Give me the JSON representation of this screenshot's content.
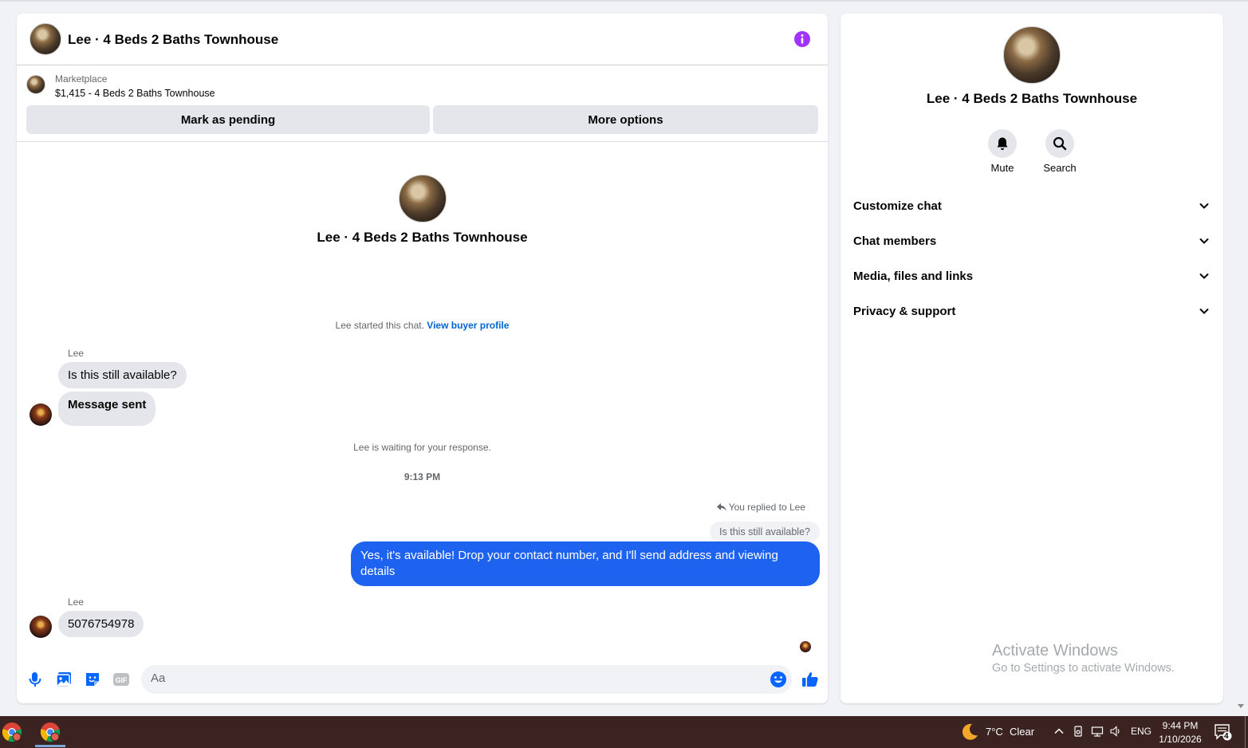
{
  "conversation": {
    "title": "Lee · 4 Beds 2 Baths Townhouse",
    "marketplace_label": "Marketplace",
    "listing": "$1,415 - 4 Beds 2 Baths Townhouse",
    "mark_pending_label": "Mark as pending",
    "more_options_label": "More options",
    "center_title": "Lee · 4 Beds 2 Baths Townhouse",
    "started_text": "Lee started this chat.",
    "view_profile_link": "View buyer profile"
  },
  "messages": {
    "group1_sender": "Lee",
    "msg1": "Is this still available?",
    "msg2": "Message sent",
    "waiting_text": "Lee is waiting for your response.",
    "timestamp": "9:13 PM",
    "reply_note": "You replied to Lee",
    "reply_quote": "Is this still available?",
    "outgoing": "Yes, it's available! Drop your contact number, and I'll send address and viewing details",
    "group2_sender": "Lee",
    "msg3": "5076754978"
  },
  "composer": {
    "placeholder": "Aa"
  },
  "side_panel": {
    "title": "Lee · 4 Beds 2 Baths Townhouse",
    "mute_label": "Mute",
    "search_label": "Search",
    "sections": [
      "Customize chat",
      "Chat members",
      "Media, files and links",
      "Privacy & support"
    ]
  },
  "watermark": {
    "line1": "Activate Windows",
    "line2": "Go to Settings to activate Windows."
  },
  "taskbar": {
    "temperature": "7°C",
    "weather": "Clear",
    "language": "ENG",
    "time": "9:44 PM",
    "date": "1/10/2026",
    "notification_count": "4"
  },
  "colors": {
    "accent": "#1e62f0",
    "info": "#a033ff",
    "link": "#0064d1"
  }
}
